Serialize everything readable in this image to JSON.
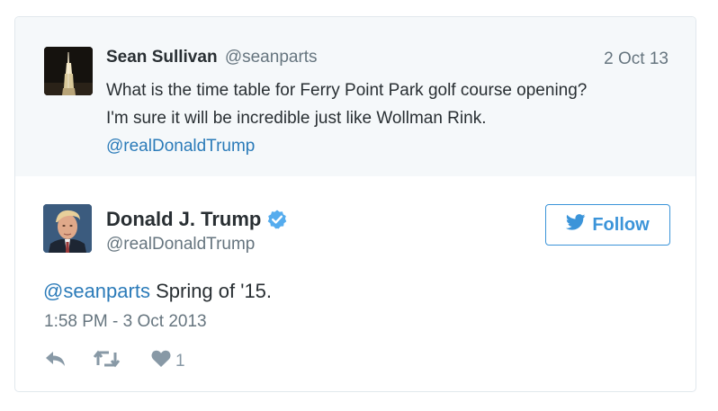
{
  "parent_tweet": {
    "author_name": "Sean Sullivan",
    "author_handle": "@seanparts",
    "date": "2 Oct 13",
    "text_line1": "What is the time table for Ferry Point Park golf course opening?",
    "text_line2": "I'm sure it will be incredible just like Wollman Rink.",
    "mention": "@realDonaldTrump"
  },
  "tweet": {
    "author_name": "Donald J. Trump",
    "author_handle": "@realDonaldTrump",
    "verified": true,
    "follow_label": "Follow",
    "mention": "@seanparts",
    "text": "Spring of '15.",
    "timestamp": "1:58 PM - 3 Oct 2013",
    "like_count": "1"
  },
  "icons": {
    "verified": "verified-badge-icon",
    "bird": "twitter-bird-icon",
    "reply": "reply-icon",
    "retweet": "retweet-icon",
    "like": "heart-icon"
  },
  "colors": {
    "link": "#2b7bb9",
    "follow": "#3b94d9",
    "muted": "#66757f",
    "action": "#8899a6",
    "parent_bg": "#f5f8fa",
    "border": "#e1e8ed"
  }
}
